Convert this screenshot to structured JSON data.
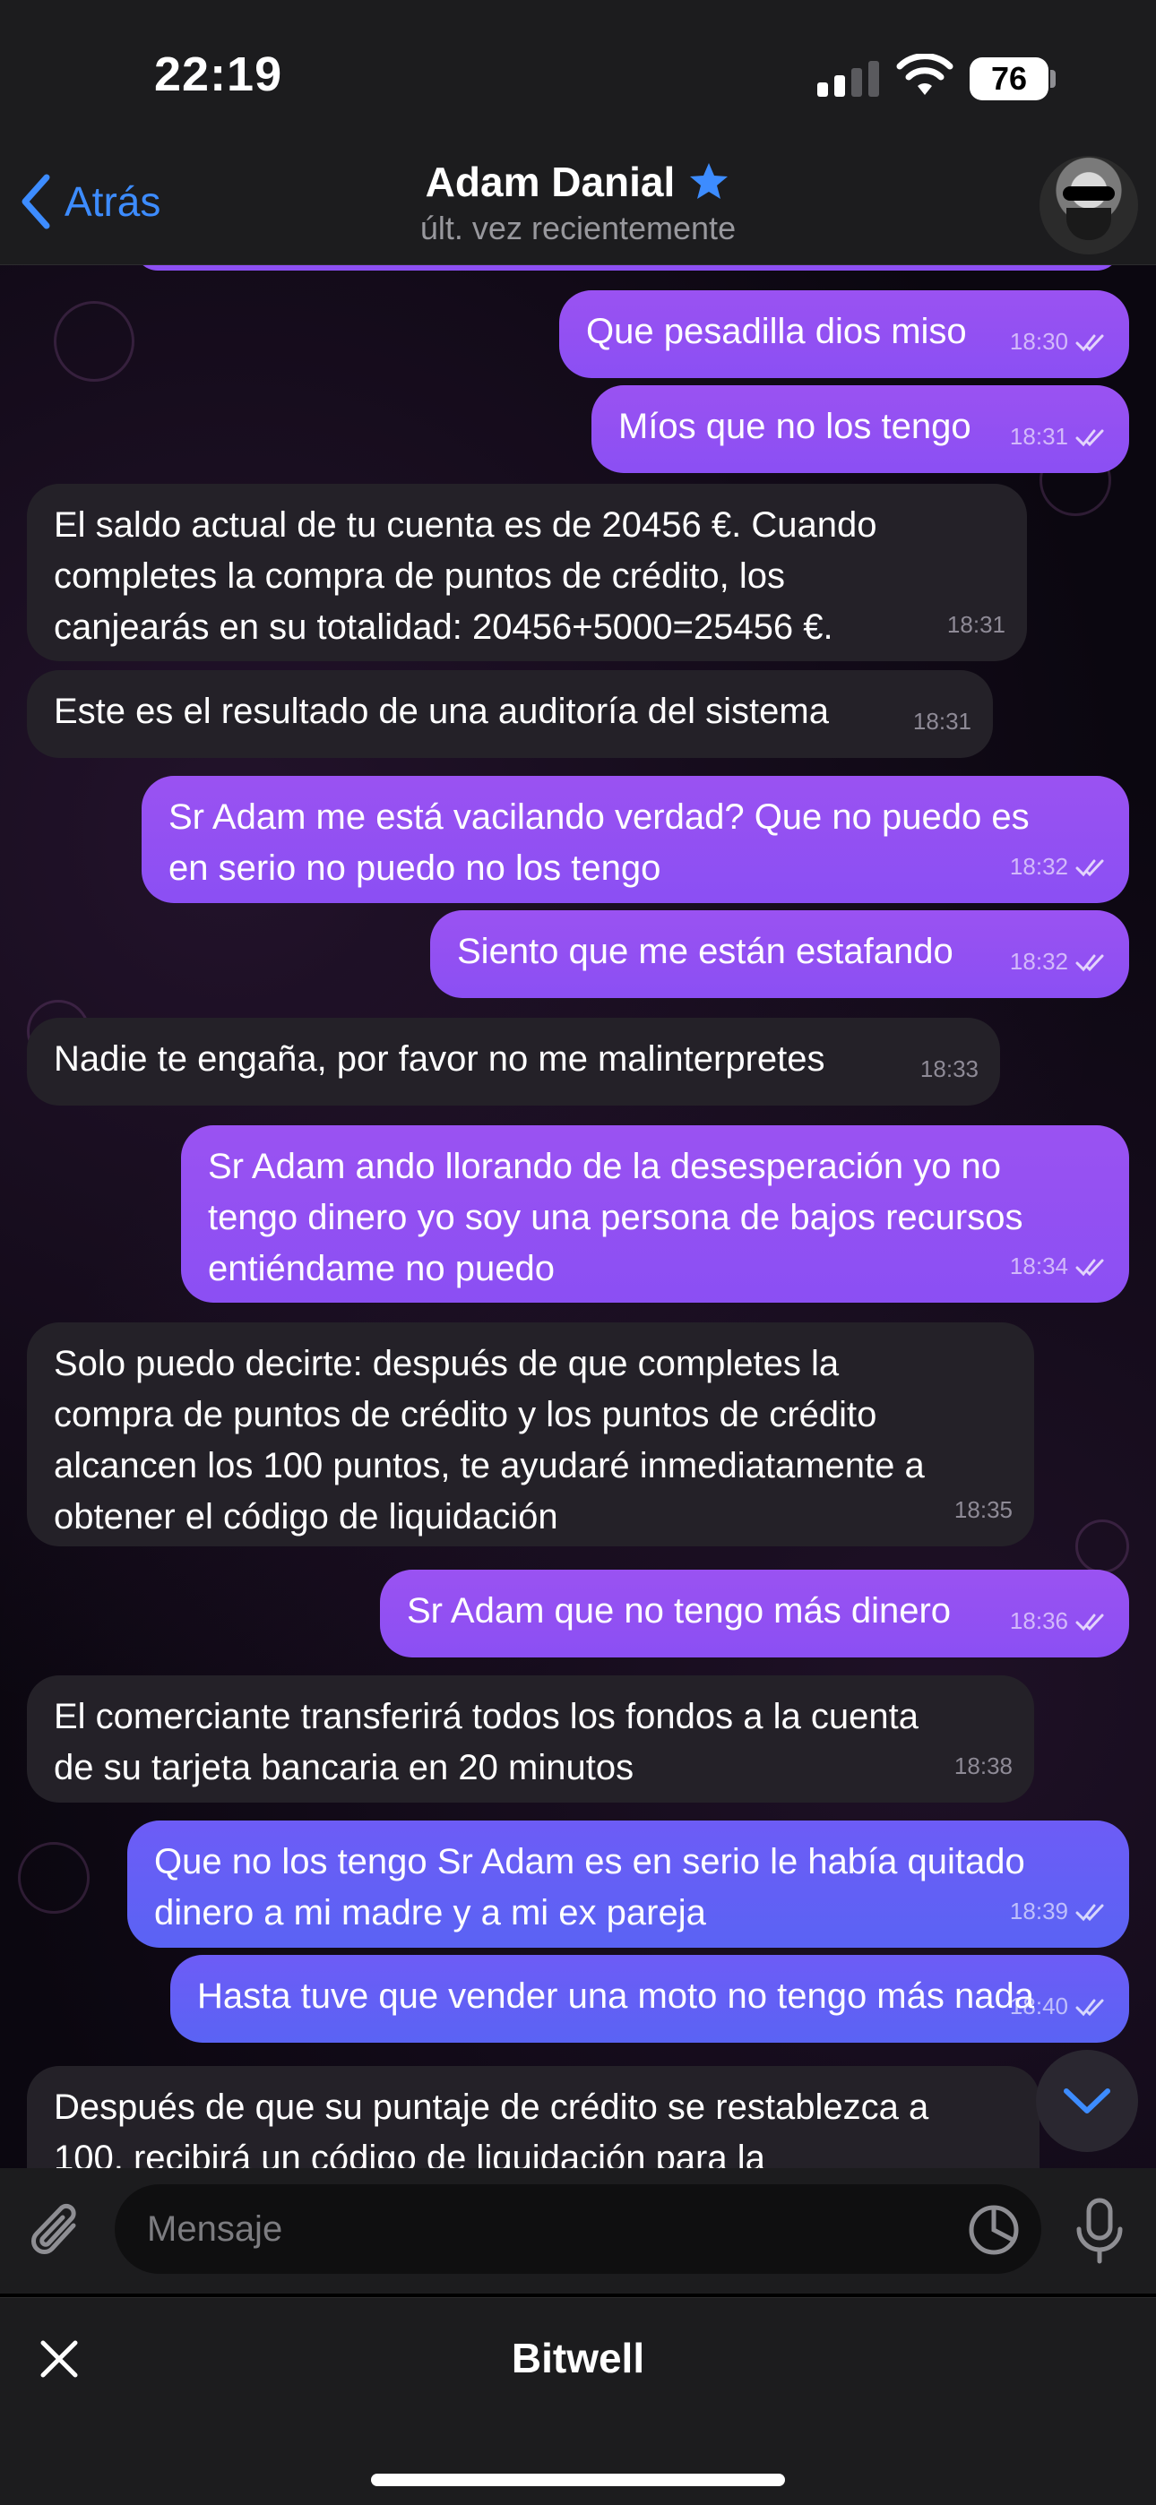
{
  "status_bar": {
    "time": "22:19",
    "battery": "76"
  },
  "header": {
    "back_label": "Atrás",
    "title": "Adam Danial",
    "subtitle": "últ. vez recientemente"
  },
  "messages": [
    {
      "dir": "out",
      "text": "Que pesadilla dios miso",
      "time": "18:30"
    },
    {
      "dir": "out",
      "text": "Míos que no los tengo",
      "time": "18:31"
    },
    {
      "dir": "in",
      "text": "El saldo actual de tu cuenta es de 20456 €. Cuando\ncompletes la compra de puntos de crédito, los\ncanjearás en su totalidad: 20456+5000=25456 €.",
      "time": "18:31"
    },
    {
      "dir": "in",
      "text": "Este es el resultado de una auditoría del sistema",
      "time": "18:31"
    },
    {
      "dir": "out",
      "text": "Sr Adam me está vacilando verdad? Que no puedo es\nen serio no puedo no los tengo",
      "time": "18:32"
    },
    {
      "dir": "out",
      "text": "Siento que me están estafando",
      "time": "18:32"
    },
    {
      "dir": "in",
      "text": "Nadie te engaña, por favor no me malinterpretes",
      "time": "18:33"
    },
    {
      "dir": "out",
      "text": "Sr Adam ando llorando de la desesperación yo no\ntengo dinero yo soy una persona de bajos recursos\nentiéndame no puedo",
      "time": "18:34"
    },
    {
      "dir": "in",
      "text": "Solo puedo decirte: después de que completes la\ncompra de puntos de crédito y los puntos de crédito\nalcancen los 100 puntos, te ayudaré inmediatamente a\nobtener el código de liquidación",
      "time": "18:35"
    },
    {
      "dir": "out",
      "text": "Sr Adam que no tengo más dinero",
      "time": "18:36"
    },
    {
      "dir": "in",
      "text": "El comerciante transferirá todos los fondos a la cuenta\nde su tarjeta bancaria en 20 minutos",
      "time": "18:38"
    },
    {
      "dir": "out",
      "text": "Que no los tengo Sr Adam es en serio le había quitado\ndinero a mi madre y a mi ex pareja",
      "time": "18:39"
    },
    {
      "dir": "out",
      "text": "Hasta tuve que vender una moto no tengo más nada",
      "time": "18:40"
    },
    {
      "dir": "in",
      "text": "Después de que su puntaje de crédito se restablezca a\n100, recibirá un código de liquidación para la",
      "time": ""
    }
  ],
  "input": {
    "placeholder": "Mensaje"
  },
  "banner": {
    "title": "Bitwell"
  },
  "colors": {
    "accent": "#3d8cff",
    "outgoing": "#9a52f2",
    "outgoing_blue": "#6d5cf6",
    "incoming": "#242128"
  },
  "icons": [
    "back-chevron-icon",
    "verified-star-icon",
    "read-check-icon",
    "scroll-down-icon",
    "attach-icon",
    "sticker-icon",
    "mic-icon",
    "close-icon"
  ]
}
